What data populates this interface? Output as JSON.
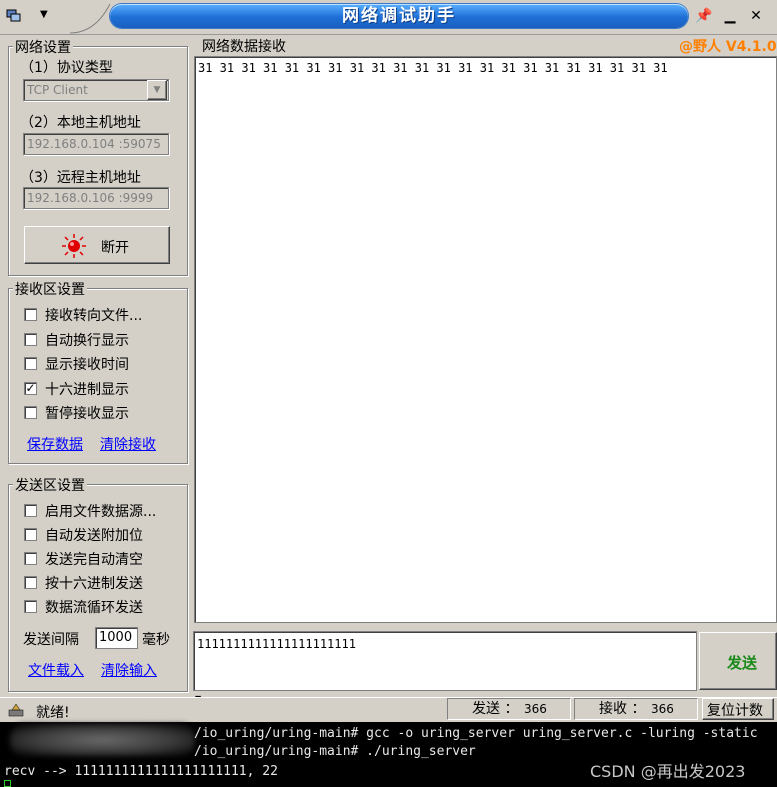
{
  "window": {
    "title": "网络调试助手",
    "version_badge": "@野人 V4.1.0"
  },
  "network_settings": {
    "legend": "网络设置",
    "protocol_label": "（1）协议类型",
    "protocol_value": "TCP Client",
    "local_label": "（2）本地主机地址",
    "local_value": "192.168.0.104 :59075",
    "remote_label": "（3）远程主机地址",
    "remote_value": "192.168.0.106 :9999",
    "connect_button": "断开"
  },
  "receive_settings": {
    "legend": "接收区设置",
    "options": [
      {
        "label": "接收转向文件...",
        "checked": false
      },
      {
        "label": "自动换行显示",
        "checked": false
      },
      {
        "label": "显示接收时间",
        "checked": false
      },
      {
        "label": "十六进制显示",
        "checked": true
      },
      {
        "label": "暂停接收显示",
        "checked": false
      }
    ],
    "save_link": "保存数据",
    "clear_link": "清除接收"
  },
  "send_settings": {
    "legend": "发送区设置",
    "options": [
      {
        "label": "启用文件数据源...",
        "checked": false
      },
      {
        "label": "自动发送附加位",
        "checked": false
      },
      {
        "label": "发送完自动清空",
        "checked": false
      },
      {
        "label": "按十六进制发送",
        "checked": false
      },
      {
        "label": "数据流循环发送",
        "checked": false
      }
    ],
    "interval_label": "发送间隔",
    "interval_value": "1000",
    "interval_unit": "毫秒",
    "load_link": "文件载入",
    "clear_link": "清除输入"
  },
  "receive_area": {
    "legend": "网络数据接收",
    "content": "31 31 31 31 31 31 31 31 31 31 31 31 31 31 31 31 31 31 31 31 31 31"
  },
  "send_area": {
    "content": "1111111111111111111111",
    "send_button": "发送"
  },
  "status_bar": {
    "status": "就绪!",
    "sent_label": "发送 ：",
    "sent_count": "366",
    "recv_label": "接收 ：",
    "recv_count": "366",
    "reset_button": "复位计数"
  },
  "terminal": {
    "lines": [
      "/io_uring/uring-main# gcc -o uring_server uring_server.c -luring -static",
      "/io_uring/uring-main# ./uring_server",
      "recv --> 1111111111111111111111, 22"
    ]
  },
  "watermark": "CSDN @再出发2023",
  "colors": {
    "title_blue": "#1e6fd6",
    "version_orange": "#ff8000",
    "link_blue": "#0000ff",
    "send_green": "#1a8a1a",
    "led_red": "#e00000"
  }
}
